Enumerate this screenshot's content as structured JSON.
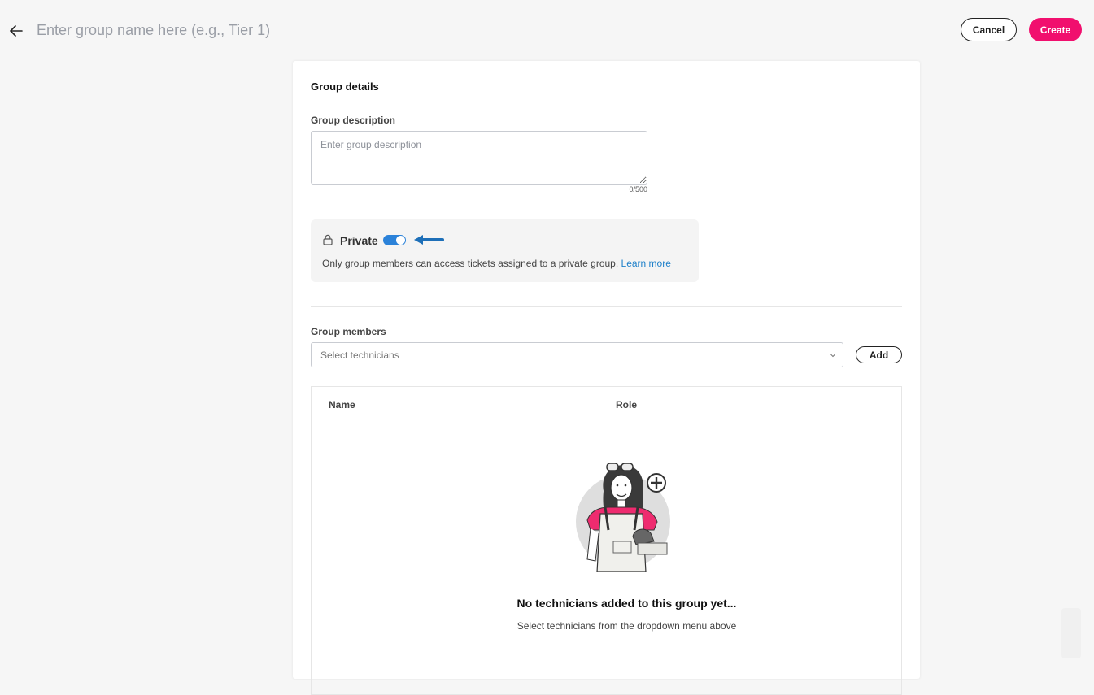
{
  "header": {
    "name_placeholder": "Enter group name here (e.g., Tier 1)",
    "cancel_label": "Cancel",
    "create_label": "Create"
  },
  "colors": {
    "accent": "#f10f6e",
    "toggle_on": "#2b82d9",
    "link": "#1f80c9"
  },
  "group_details": {
    "title": "Group details",
    "description_label": "Group description",
    "description_placeholder": "Enter group description",
    "description_value": "",
    "char_count": "0/500",
    "private": {
      "label": "Private",
      "enabled": true,
      "description": "Only group members can access tickets assigned to a private group.",
      "learn_more": "Learn more"
    }
  },
  "group_members": {
    "label": "Group members",
    "select_placeholder": "Select technicians",
    "add_label": "Add",
    "columns": [
      "Name",
      "Role"
    ],
    "rows": [],
    "empty_title": "No technicians added to this group yet...",
    "empty_subtitle": "Select technicians from the dropdown menu above"
  }
}
